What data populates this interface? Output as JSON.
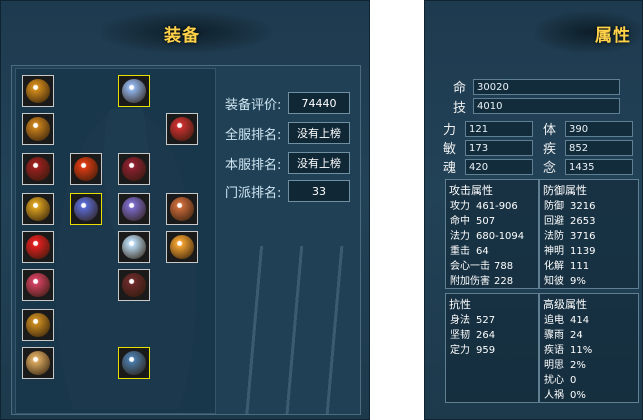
{
  "equipment": {
    "title": "装备",
    "slots": [
      {
        "icon": "amulet-gold-icon",
        "color": "#d08a1c"
      },
      {
        "icon": "armor-crystal-icon",
        "color": "#8fb2e8",
        "selected": true
      },
      {
        "icon": "amulet-gold-icon-2",
        "color": "#c7801c"
      },
      {
        "icon": "cape-red-icon",
        "color": "#c83030"
      },
      {
        "icon": "necklace-red-icon",
        "color": "#9a2020"
      },
      {
        "icon": "flame-red-icon",
        "color": "#d83a12"
      },
      {
        "icon": "robe-red-icon",
        "color": "#8c2030"
      },
      {
        "icon": "ring-gold-icon",
        "color": "#d8a020"
      },
      {
        "icon": "blade-blue-icon",
        "color": "#5a6ad0",
        "selected": true
      },
      {
        "icon": "mask-purple-icon",
        "color": "#7a6ac8"
      },
      {
        "icon": "warrior-figure-icon",
        "color": "#c86a3a"
      },
      {
        "icon": "gem-red-icon",
        "color": "#e02020"
      },
      {
        "icon": "ice-armor-icon",
        "color": "#b8d8f0"
      },
      {
        "icon": "orb-fire-icon",
        "color": "#f0a030"
      },
      {
        "icon": "bracelet-gem-icon",
        "color": "#d04060"
      },
      {
        "icon": "pants-dark-icon",
        "color": "#6a2a2a"
      },
      {
        "icon": "pendant-gold-icon",
        "color": "#c88a20"
      },
      {
        "icon": "charm-swirl-icon",
        "color": "#d8a860"
      },
      {
        "icon": "boots-blue-icon",
        "color": "#4a7aa8",
        "selected": true
      }
    ],
    "stats": [
      {
        "label": "装备评价:",
        "value": "74440"
      },
      {
        "label": "全服排名:",
        "value": "没有上榜"
      },
      {
        "label": "本服排名:",
        "value": "没有上榜"
      },
      {
        "label": "门派排名:",
        "value": "33"
      }
    ]
  },
  "attributes": {
    "title": "属性",
    "hp": {
      "label": "命",
      "value": "30020"
    },
    "mp": {
      "label": "技",
      "value": "4010"
    },
    "base": [
      {
        "label": "力",
        "value": "121"
      },
      {
        "label": "体",
        "value": "390"
      },
      {
        "label": "敏",
        "value": "173"
      },
      {
        "label": "疾",
        "value": "852"
      },
      {
        "label": "魂",
        "value": "420"
      },
      {
        "label": "念",
        "value": "1435"
      }
    ],
    "attack": {
      "title": "攻击属性",
      "items": [
        {
          "k": "攻力",
          "v": "461-906"
        },
        {
          "k": "命中",
          "v": "507"
        },
        {
          "k": "法力",
          "v": "680-1094"
        },
        {
          "k": "重击",
          "v": "64"
        },
        {
          "k": "会心一击",
          "v": "788"
        },
        {
          "k": "附加伤害",
          "v": "228"
        }
      ]
    },
    "defense": {
      "title": "防御属性",
      "items": [
        {
          "k": "防御",
          "v": "3216"
        },
        {
          "k": "回避",
          "v": "2653"
        },
        {
          "k": "法防",
          "v": "3716"
        },
        {
          "k": "神明",
          "v": "1139"
        },
        {
          "k": "化解",
          "v": "111"
        },
        {
          "k": "知彼",
          "v": "9%"
        }
      ]
    },
    "resist": {
      "title": "抗性",
      "items": [
        {
          "k": "身法",
          "v": "527"
        },
        {
          "k": "坚韧",
          "v": "264"
        },
        {
          "k": "定力",
          "v": "959"
        }
      ]
    },
    "advanced": {
      "title": "高级属性",
      "items": [
        {
          "k": "追电",
          "v": "414"
        },
        {
          "k": "骤雨",
          "v": "24"
        },
        {
          "k": "疾语",
          "v": "11%"
        },
        {
          "k": "明思",
          "v": "2%"
        },
        {
          "k": "扰心",
          "v": "0"
        },
        {
          "k": "人祸",
          "v": "0%"
        }
      ]
    }
  }
}
